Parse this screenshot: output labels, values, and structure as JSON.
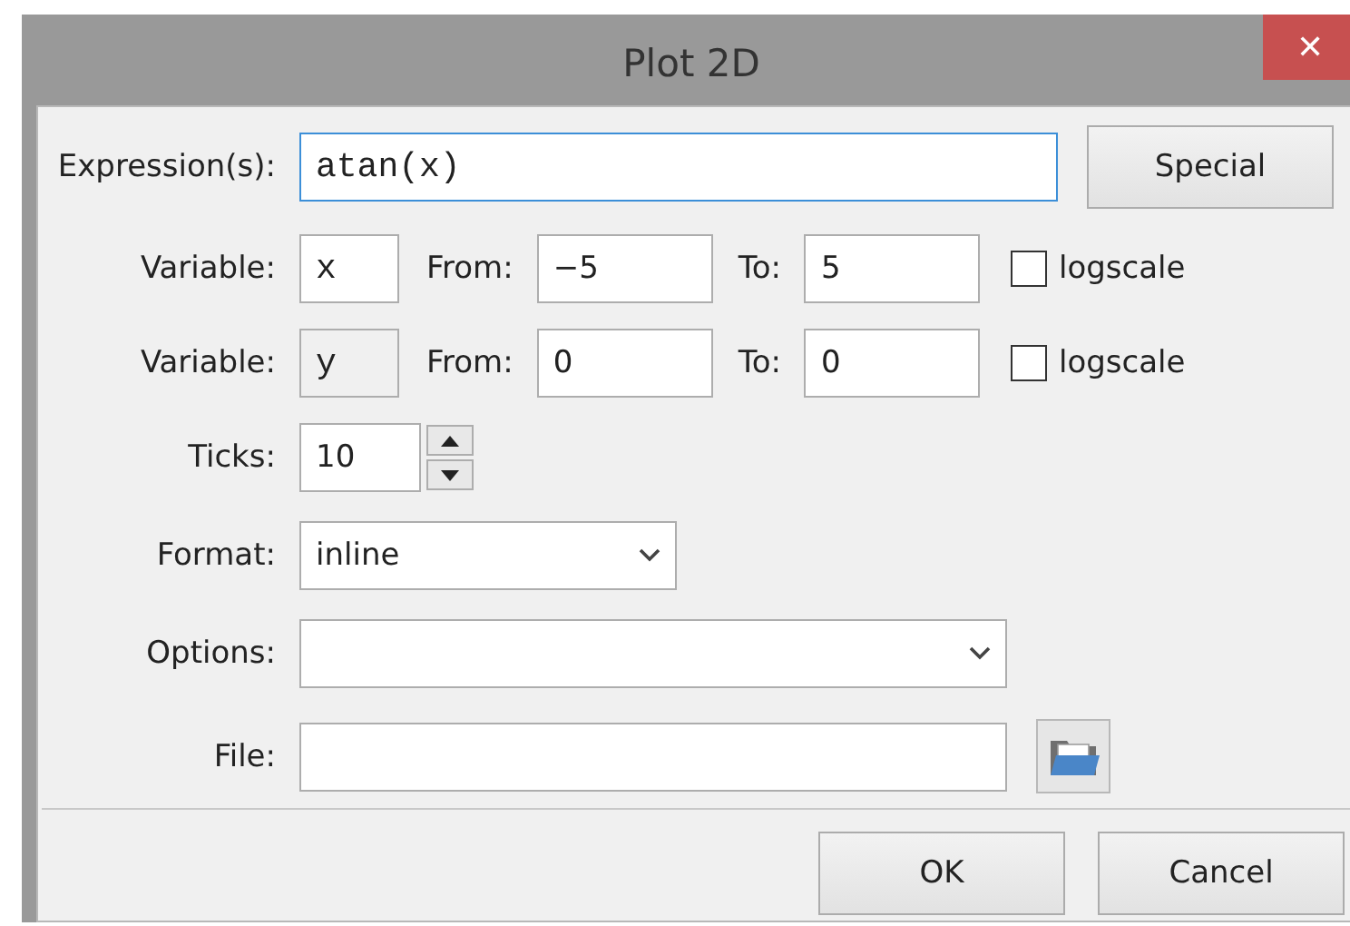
{
  "window": {
    "title": "Plot 2D",
    "close": "✕"
  },
  "expression": {
    "label": "Expression(s):",
    "value": "atan(x)",
    "focused": true
  },
  "special_button": "Special",
  "variables": [
    {
      "label": "Variable:",
      "value": "x",
      "disabled": false,
      "from_label": "From:",
      "from": "−5",
      "to_label": "To:",
      "to": "5",
      "logscale_label": "logscale",
      "logscale": false
    },
    {
      "label": "Variable:",
      "value": "y",
      "disabled": true,
      "from_label": "From:",
      "from": "0",
      "to_label": "To:",
      "to": "0",
      "logscale_label": "logscale",
      "logscale": false
    }
  ],
  "ticks": {
    "label": "Ticks:",
    "value": "10"
  },
  "format": {
    "label": "Format:",
    "value": "inline"
  },
  "options": {
    "label": "Options:"
  },
  "file": {
    "label": "File:"
  },
  "buttons": [
    "OK",
    "Cancel"
  ]
}
